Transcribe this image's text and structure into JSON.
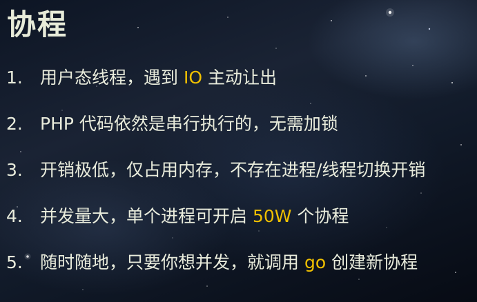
{
  "slide": {
    "title": "协程",
    "items": [
      {
        "num": "1.",
        "before": "用户态线程，遇到 ",
        "highlight": "IO",
        "after": " 主动让出"
      },
      {
        "num": "2.",
        "before": "PHP 代码依然是串行执行的，无需加锁",
        "highlight": "",
        "after": ""
      },
      {
        "num": "3.",
        "before": "开销极低，仅占用内存，不存在进程/线程切换开销",
        "highlight": "",
        "after": ""
      },
      {
        "num": "4.",
        "before": "并发量大，单个进程可开启 ",
        "highlight": "50W",
        "after": " 个协程"
      },
      {
        "num": "5.",
        "before": "随时随地，只要你想并发，就调用 ",
        "highlight": "go",
        "after": " 创建新协程"
      }
    ],
    "colors": {
      "text": "#e9ecdc",
      "highlight": "#f0c000",
      "background": "#111a29"
    }
  }
}
